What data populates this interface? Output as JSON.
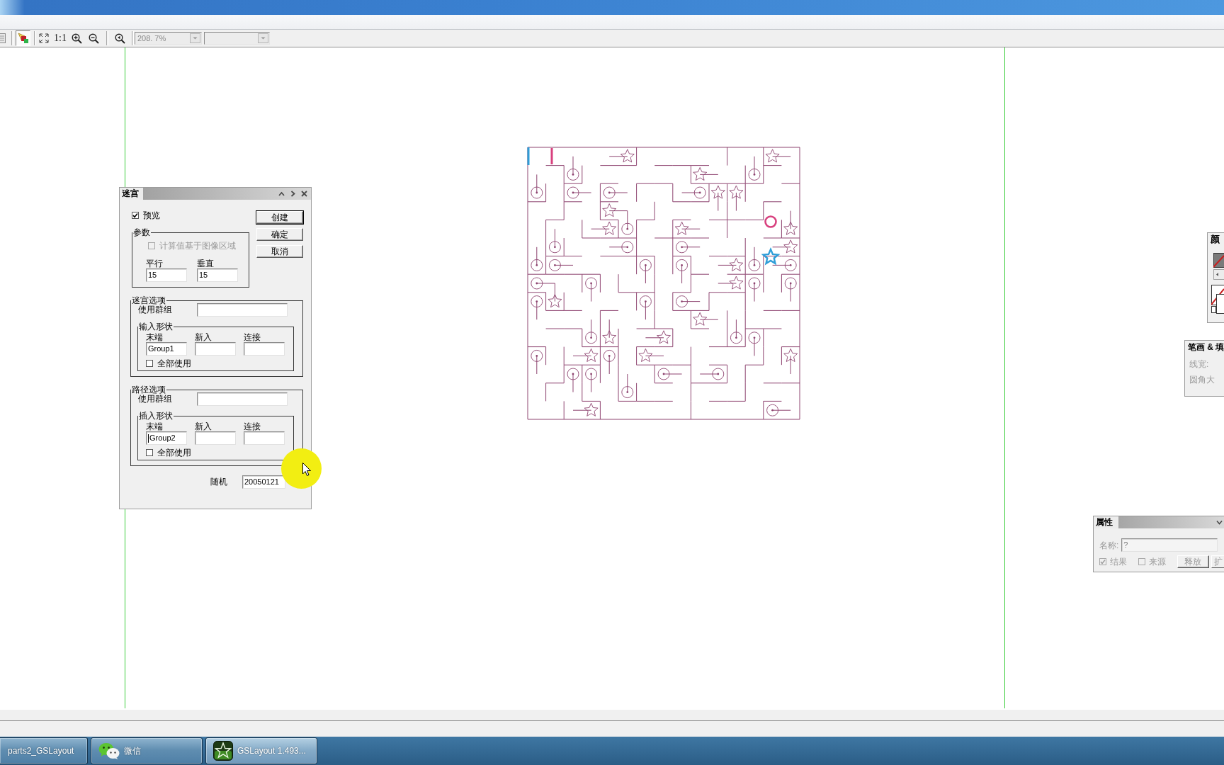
{
  "toolbar": {
    "shape_tool": {
      "selected": true
    },
    "actual_size_label": "1:1",
    "zoom_combo": {
      "value": "208. 7%",
      "disabled": true
    }
  },
  "maze_dialog": {
    "title": "迷宫",
    "preview": {
      "label": "预览",
      "checked": true
    },
    "buttons": [
      {
        "label": "创建",
        "default": true
      },
      {
        "label": "确定",
        "default": false
      },
      {
        "label": "取消",
        "default": false
      }
    ],
    "parameters": {
      "legend": "参数",
      "image_area_option": {
        "label": "计算值基于图像区域",
        "checked": false,
        "disabled": true
      },
      "fields": [
        {
          "label": "平行",
          "value": "15"
        },
        {
          "label": "垂直",
          "value": "15"
        }
      ]
    },
    "option_groups": [
      {
        "legend": "迷宫选项",
        "group_label": "使用群组",
        "shapes": {
          "legend": "输入形状",
          "fields": [
            {
              "label": "末端",
              "value": "Group1",
              "focused": false
            },
            {
              "label": "新入",
              "focused": false
            },
            {
              "label": "连接",
              "focused": false
            }
          ],
          "use_all": {
            "label": "全部使用",
            "checked": false
          }
        }
      },
      {
        "legend": "路径选项",
        "group_label": "使用群组",
        "shapes": {
          "legend": "插入形状",
          "fields": [
            {
              "label": "末端",
              "value": "Group2",
              "focused": true
            },
            {
              "label": "新入",
              "focused": false
            },
            {
              "label": "连接",
              "focused": false
            }
          ],
          "use_all": {
            "label": "全部使用",
            "checked": false
          }
        }
      }
    ],
    "random_seed": {
      "label": "随机",
      "value": "20050121"
    }
  },
  "color_panel": {
    "title": "颜"
  },
  "stroke_fill_panel": {
    "title": "笔画 & 填",
    "fields": [
      {
        "label": "线宽:",
        "disabled": true
      },
      {
        "label": "圆角大",
        "disabled": true
      }
    ]
  },
  "properties_panel": {
    "title": "属性",
    "name_field": {
      "label": "名称:",
      "value": "?",
      "disabled": true
    },
    "checkboxes": [
      {
        "label": "结果",
        "checked": true,
        "disabled": true
      },
      {
        "label": "来源",
        "checked": false,
        "disabled": true
      }
    ],
    "buttons": [
      {
        "label": "释放",
        "disabled": true
      },
      {
        "label": "扩",
        "disabled": true
      }
    ]
  },
  "taskbar": {
    "buttons": [
      {
        "label": "parts2_GSLayout",
        "selected": false
      },
      {
        "label": "微信",
        "selected": false
      },
      {
        "label": "GSLayout 1.493...",
        "selected": true
      }
    ]
  }
}
